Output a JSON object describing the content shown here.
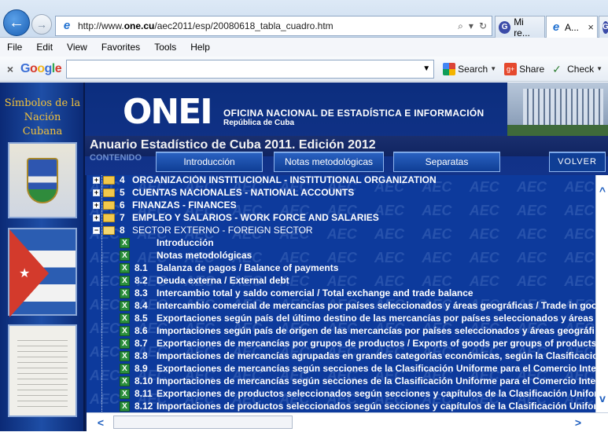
{
  "browser": {
    "url_prefix": "http://www.",
    "url_domain": "one.cu",
    "url_path": "/aec2011/esp/20080618_tabla_cuadro.htm",
    "addr_search": "⌕",
    "addr_dropdown": "▾",
    "addr_refresh": "↻",
    "tab1": {
      "icon": "G",
      "label": "Mi re..."
    },
    "tab2": {
      "label": "A...",
      "close": "×"
    },
    "tab3": {
      "icon": "G"
    }
  },
  "menu": [
    "File",
    "Edit",
    "View",
    "Favorites",
    "Tools",
    "Help"
  ],
  "googlebar": {
    "close": "×",
    "logo": [
      "G",
      "o",
      "o",
      "g",
      "l",
      "e"
    ],
    "search_label": "Search",
    "share_label": "Share",
    "check_label": "Check"
  },
  "leftbar": {
    "title_line1": "Símbolos de la",
    "title_line2": "Nación Cubana"
  },
  "header": {
    "logo_text": "ONEI",
    "org_name": "OFICINA NACIONAL DE ESTADÍSTICA E INFORMACIÓN",
    "org_sub": "República de Cuba",
    "yearbook_title": "Anuario Estadístico de Cuba 2011.  Edición 2012",
    "contenido": "CONTENIDO",
    "buttons": {
      "intro": "Introducción",
      "notas": "Notas metodológicas",
      "separatas": "Separatas",
      "volver": "VOLVER"
    }
  },
  "tree": {
    "watermark": "AEC",
    "rows": [
      {
        "type": "section",
        "num": "4",
        "label": "ORGANIZACIÓN INSTITUCIONAL - INSTITUTIONAL ORGANIZATION",
        "expanded": false
      },
      {
        "type": "section",
        "num": "5",
        "label": "CUENTAS NACIONALES - NATIONAL ACCOUNTS",
        "expanded": false
      },
      {
        "type": "section",
        "num": "6",
        "label": "FINANZAS - FINANCES",
        "expanded": false
      },
      {
        "type": "section",
        "num": "7",
        "label": "EMPLEO Y SALARIOS - WORK FORCE AND SALARIES",
        "expanded": false
      },
      {
        "type": "section",
        "num": "8",
        "label": "SECTOR EXTERNO - FOREIGN SECTOR",
        "expanded": true
      },
      {
        "type": "item",
        "num": "",
        "label": "Introducción"
      },
      {
        "type": "item",
        "num": "",
        "label": "Notas metodológicas"
      },
      {
        "type": "item",
        "num": "8.1",
        "label": "Balanza de pagos / Balance of payments"
      },
      {
        "type": "item",
        "num": "8.2",
        "label": "Deuda externa / External debt"
      },
      {
        "type": "item",
        "num": "8.3",
        "label": "Intercambio total y saldo comercial / Total exchange and trade balance"
      },
      {
        "type": "item",
        "num": "8.4",
        "label": "Intercambio comercial de mercancías por países seleccionados y áreas geográficas / Trade in goo"
      },
      {
        "type": "item",
        "num": "8.5",
        "label": "Exportaciones según país del último destino de las mercancías por países seleccionados y áreas"
      },
      {
        "type": "item",
        "num": "8.6",
        "label": "Importaciones según país de origen de las mercancías por países seleccionados y áreas geográfi"
      },
      {
        "type": "item",
        "num": "8.7",
        "label": "Exportaciones de mercancías por grupos de productos / Exports of goods per groups of products"
      },
      {
        "type": "item",
        "num": "8.8",
        "label": "Importaciones de mercancías agrupadas en grandes categorías económicas, según la Clasificacio"
      },
      {
        "type": "item",
        "num": "8.9",
        "label": "Exportaciones de mercancías según secciones de la Clasificación Uniforme para el Comercio Inte"
      },
      {
        "type": "item",
        "num": "8.10",
        "label": "Importaciones de mercancías según secciones de la Clasificación Uniforme para el Comercio Inte"
      },
      {
        "type": "item",
        "num": "8.11",
        "label": "Exportaciones de productos seleccionados según secciones y capítulos de la Clasificación Unifor"
      },
      {
        "type": "item",
        "num": "8.12",
        "label": "Importaciones de productos seleccionados según secciones y capítulos de la Clasificación Unifor"
      }
    ]
  },
  "scroll": {
    "up": "^",
    "down": "v",
    "left": "<",
    "right": ">"
  },
  "colors": {
    "page_bg": "#0a1f5c",
    "tree_bg": "#0d3a9c",
    "accent_gold": "#f3c23a"
  }
}
